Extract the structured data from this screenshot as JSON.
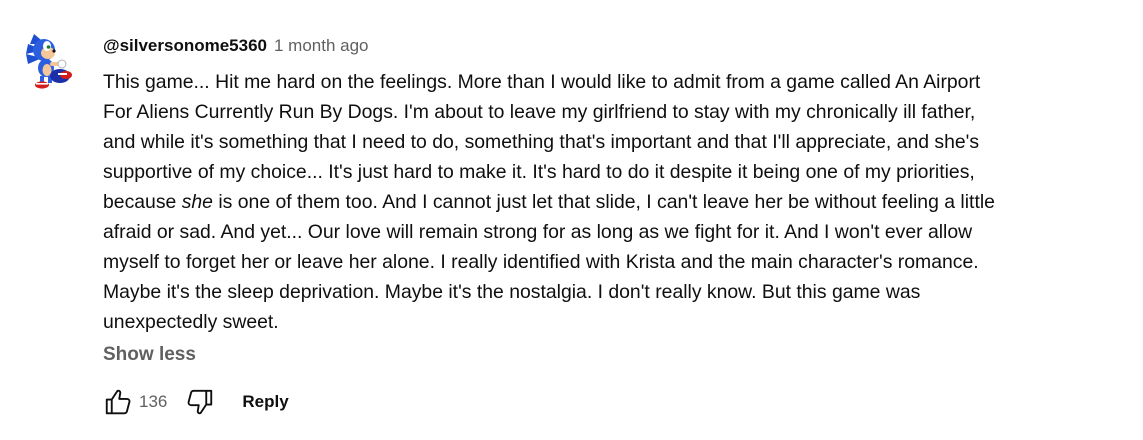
{
  "comment": {
    "author": "@silversonome5360",
    "time": "1 month ago",
    "avatar_icon": "sonic-character-icon",
    "text_lines": {
      "l1": "This game... Hit me hard on the feelings. More than I would like to admit from a game called An Airport",
      "l2": "For Aliens Currently Run By Dogs. I'm about to leave my girlfriend to stay with my chronically ill father,",
      "l3": "and while it's something that I need to do, something that's important and that I'll appreciate, and she's",
      "l4": "supportive of my choice... It's just hard to make it. It's hard to do it despite it being one of my priorities,",
      "l5_pre": "because ",
      "l5_em": "she",
      "l5_post": " is one of them too. And I cannot just let that slide, I can't leave her be without feeling a little",
      "l6": "afraid or sad. And yet... Our love will remain strong for as long as we fight for it. And I won't ever allow",
      "l7": "myself to forget her or leave her alone. I really identified with Krista and the main character's romance.",
      "l8": "Maybe it's the sleep deprivation. Maybe it's the nostalgia. I don't really know. But this game was",
      "l9": "unexpectedly sweet."
    },
    "show_less_label": "Show less",
    "like_count": "136",
    "reply_label": "Reply"
  },
  "icons": {
    "like": "thumbs-up-icon",
    "dislike": "thumbs-down-icon"
  },
  "colors": {
    "primary_text": "#0f0f0f",
    "secondary_text": "#606060",
    "background": "#ffffff"
  }
}
